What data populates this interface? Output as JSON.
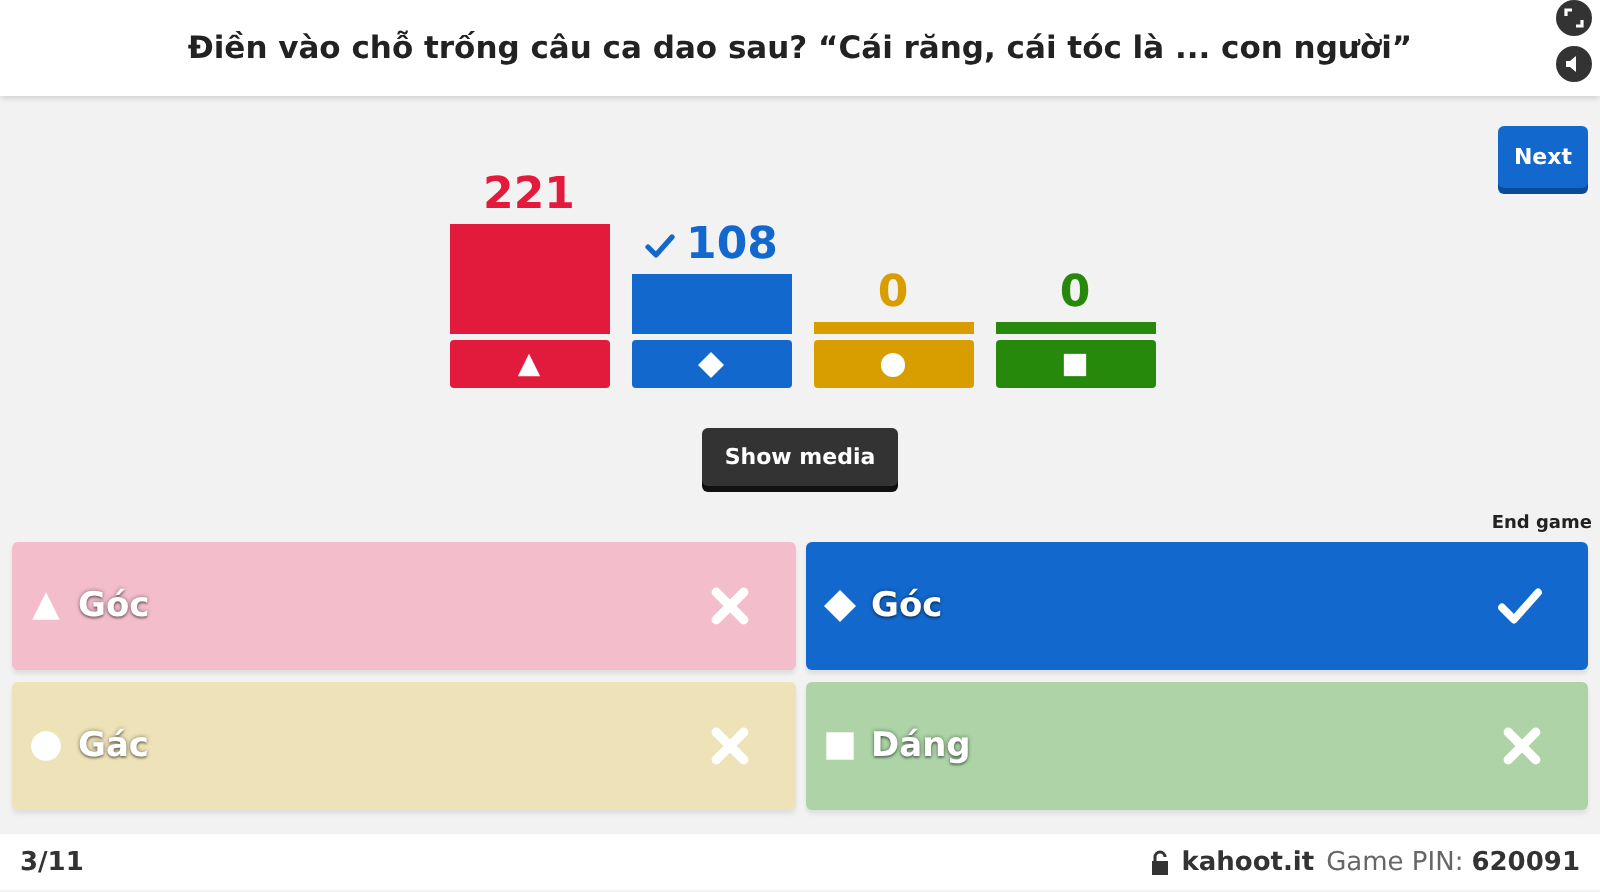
{
  "question": {
    "title": "Điền vào chỗ trống câu ca dao sau? “Cái răng, cái tóc là ... con người”"
  },
  "controls": {
    "next": "Next",
    "show_media": "Show media",
    "end_game": "End game"
  },
  "results": [
    {
      "count": "221",
      "kind": "triangle",
      "color": "#e21b3c",
      "correct": false
    },
    {
      "count": "108",
      "kind": "diamond",
      "color": "#1368ce",
      "correct": true
    },
    {
      "count": "0",
      "kind": "circle",
      "color": "#d89e00",
      "correct": false
    },
    {
      "count": "0",
      "kind": "square",
      "color": "#26890c",
      "correct": false
    }
  ],
  "answers": [
    {
      "text": "Góc",
      "kind": "triangle",
      "color": "#f3bdcc",
      "correct": false
    },
    {
      "text": "Góc",
      "kind": "diamond",
      "color": "#1368ce",
      "correct": true
    },
    {
      "text": "Gác",
      "kind": "circle",
      "color": "#eee2b8",
      "correct": false
    },
    {
      "text": "Dáng",
      "kind": "square",
      "color": "#add3a7",
      "correct": false
    }
  ],
  "footer": {
    "progress": "3/11",
    "site": "kahoot.it",
    "pin_label": "Game PIN:",
    "pin": "620091"
  }
}
